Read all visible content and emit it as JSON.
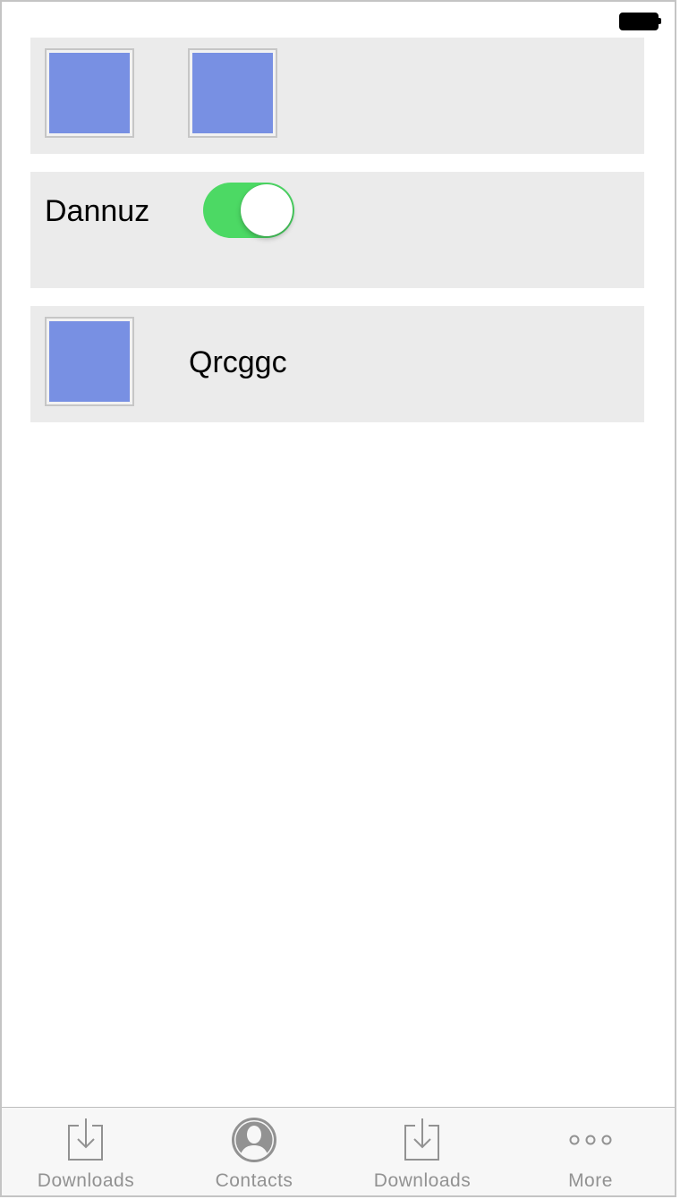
{
  "status_bar": {
    "battery_icon": "battery-full-icon"
  },
  "card_1": {
    "thumbnails": [
      "image-placeholder-icon",
      "image-placeholder-icon"
    ]
  },
  "card_2": {
    "label": "Dannuz",
    "toggle_on": true
  },
  "card_3": {
    "label": "Qrcggc",
    "thumbnail": "image-placeholder-icon"
  },
  "tab_bar": {
    "tabs": [
      {
        "label": "Downloads",
        "icon": "download-icon"
      },
      {
        "label": "Contacts",
        "icon": "contact-icon"
      },
      {
        "label": "Downloads",
        "icon": "download-icon"
      },
      {
        "label": "More",
        "icon": "more-icon"
      }
    ]
  },
  "colors": {
    "card_background": "#ebebeb",
    "thumbnail_fill": "#7890e3",
    "toggle_on": "#4cd964",
    "tab_inactive": "#929292"
  }
}
